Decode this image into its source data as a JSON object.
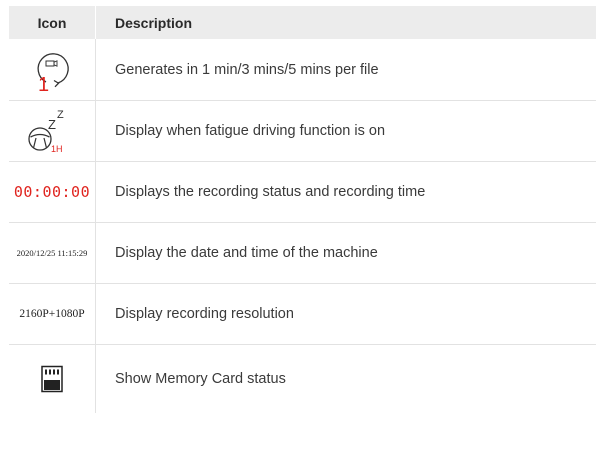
{
  "table": {
    "headers": {
      "icon": "Icon",
      "description": "Description"
    },
    "rows": [
      {
        "icon_name": "loop-recording-icon",
        "icon_text": "1",
        "description": "Generates in 1 min/3 mins/5 mins per file"
      },
      {
        "icon_name": "fatigue-driving-icon",
        "icon_text": "1H",
        "icon_sleep_large": "Z",
        "icon_sleep_small": "Z",
        "description": "Display when fatigue driving function is on"
      },
      {
        "icon_name": "recording-time-text",
        "icon_text": "00:00:00",
        "description": "Displays the recording status and recording time"
      },
      {
        "icon_name": "date-time-text",
        "icon_text": "2020/12/25 11:15:29",
        "description": "Display the date and time of the machine"
      },
      {
        "icon_name": "resolution-text",
        "icon_text": "2160P+1080P",
        "description": "Display recording resolution"
      },
      {
        "icon_name": "memory-card-icon",
        "description": "Show Memory Card status"
      }
    ]
  },
  "colors": {
    "header_bg": "#ececec",
    "accent_red": "#e0241f",
    "border": "#e2e2e2"
  }
}
